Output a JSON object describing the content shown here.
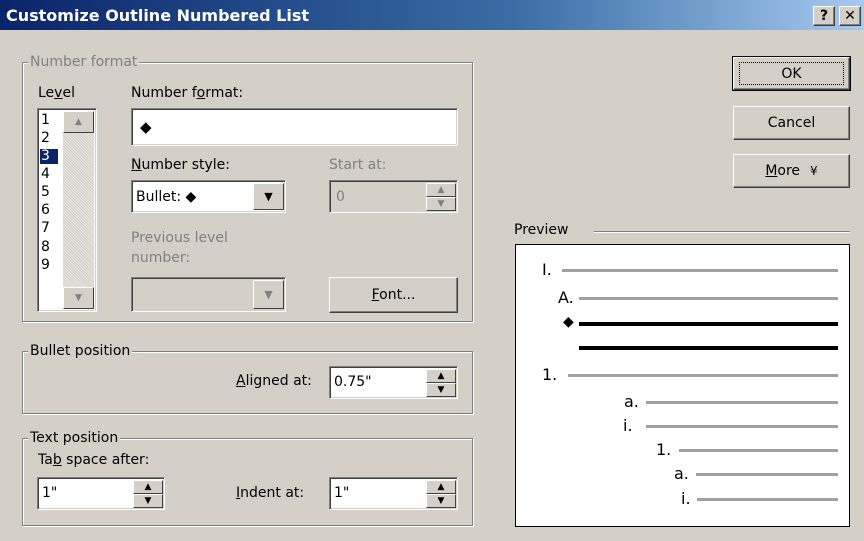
{
  "window": {
    "title": "Customize Outline Numbered List",
    "help_button": "?",
    "close_button": "✕"
  },
  "number_format_group": {
    "legend": "Number format",
    "level_label_pre": "Le",
    "level_label_u": "v",
    "level_label_post": "el",
    "levels": [
      "1",
      "2",
      "3",
      "4",
      "5",
      "6",
      "7",
      "8",
      "9"
    ],
    "selected_level": "3",
    "number_format_label_pre": "Number f",
    "number_format_label_u": "o",
    "number_format_label_post": "rmat:",
    "number_format_value": "◆",
    "number_style_label_u": "N",
    "number_style_label_post": "umber style:",
    "number_style_value": "Bullet: ◆",
    "start_at_label": "Start at:",
    "start_at_value": "0",
    "previous_level_label_1": "Previous level",
    "previous_level_label_2": "number:",
    "font_button_u": "F",
    "font_button_post": "ont..."
  },
  "bullet_position_group": {
    "legend": "Bullet position",
    "aligned_at_label_u": "A",
    "aligned_at_label_post": "ligned at:",
    "aligned_at_value": "0.75\""
  },
  "text_position_group": {
    "legend": "Text position",
    "tab_space_label_pre": "Ta",
    "tab_space_label_u": "b",
    "tab_space_label_post": " space after:",
    "tab_space_value": "1\"",
    "indent_at_label_u": "I",
    "indent_at_label_post": "ndent at:",
    "indent_at_value": "1\""
  },
  "buttons": {
    "ok": "OK",
    "cancel": "Cancel",
    "more_u": "M",
    "more_post": "ore",
    "more_arrow": "¥"
  },
  "preview": {
    "legend": "Preview",
    "labels": [
      "I.",
      "A.",
      "◆",
      "1.",
      "a.",
      "i.",
      "1.",
      "a.",
      "i."
    ]
  },
  "colors": {
    "title_bar": "#0a246a",
    "selection": "#0a246a",
    "face": "#d4d0c8",
    "preview_line": "#a0a0a0"
  }
}
